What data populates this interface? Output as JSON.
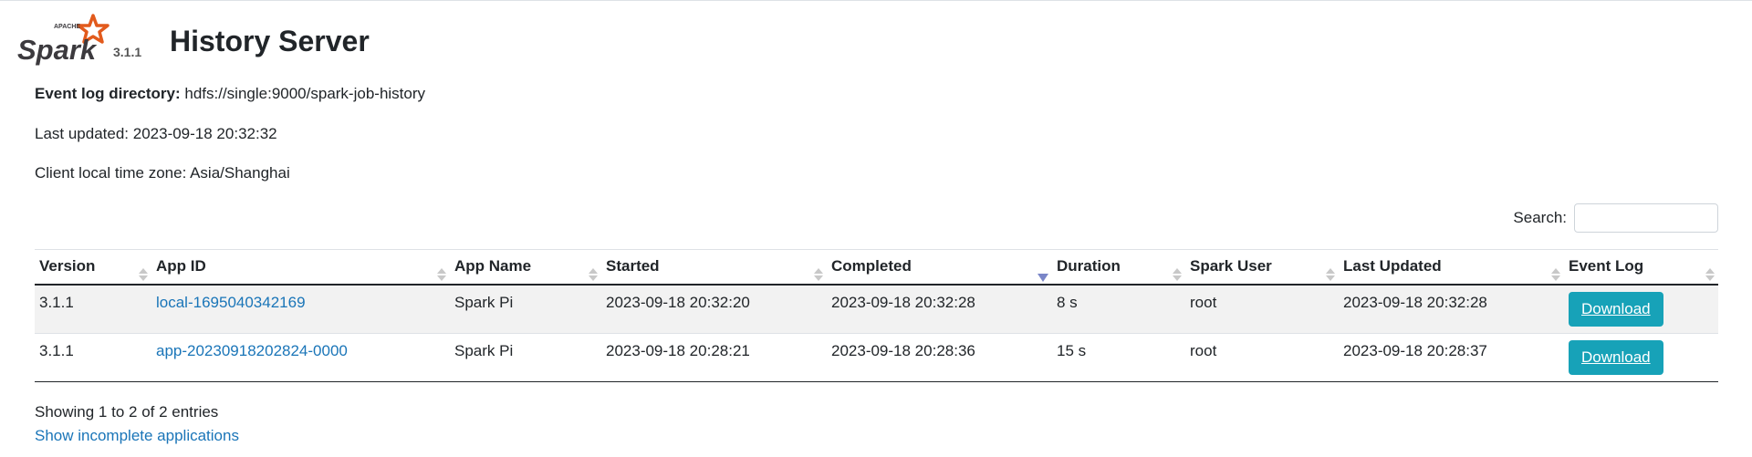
{
  "header": {
    "logo_brand": "Spark",
    "logo_apache": "APACHE",
    "version": "3.1.1",
    "title": "History Server"
  },
  "info": {
    "event_log_label": "Event log directory:",
    "event_log_value": "hdfs://single:9000/spark-job-history",
    "last_updated": "Last updated: 2023-09-18 20:32:32",
    "timezone": "Client local time zone: Asia/Shanghai"
  },
  "search": {
    "label": "Search:",
    "value": ""
  },
  "table": {
    "columns": [
      "Version",
      "App ID",
      "App Name",
      "Started",
      "Completed",
      "Duration",
      "Spark User",
      "Last Updated",
      "Event Log"
    ],
    "sorted_column": "Completed",
    "sort_direction": "descending",
    "rows": [
      {
        "version": "3.1.1",
        "app_id": "local-1695040342169",
        "app_name": "Spark Pi",
        "started": "2023-09-18 20:32:20",
        "completed": "2023-09-18 20:32:28",
        "duration": "8 s",
        "spark_user": "root",
        "last_updated": "2023-09-18 20:32:28",
        "event_log": "Download"
      },
      {
        "version": "3.1.1",
        "app_id": "app-20230918202824-0000",
        "app_name": "Spark Pi",
        "started": "2023-09-18 20:28:21",
        "completed": "2023-09-18 20:28:36",
        "duration": "15 s",
        "spark_user": "root",
        "last_updated": "2023-09-18 20:28:37",
        "event_log": "Download"
      }
    ]
  },
  "footer": {
    "showing": "Showing 1 to 2 of 2 entries",
    "incomplete_link": "Show incomplete applications"
  },
  "colors": {
    "accent_button": "#17a2b8",
    "link": "#1a75b8",
    "logo_orange": "#e25a1c",
    "sort_active": "#7a86c8"
  }
}
